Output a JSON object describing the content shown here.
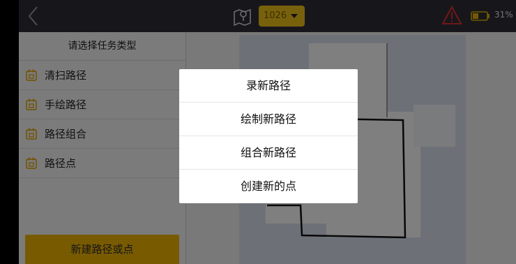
{
  "topbar": {
    "dropdown_value": "1026",
    "battery_percent": "31%",
    "accent": "#f0c21a",
    "icons": [
      "back-chevron-icon",
      "map-location-icon",
      "warning-icon",
      "battery-icon"
    ]
  },
  "panel": {
    "title": "请选择任务类型",
    "items": [
      {
        "label": "清扫路径"
      },
      {
        "label": "手绘路径"
      },
      {
        "label": "路径组合"
      },
      {
        "label": "路径点"
      }
    ],
    "new_button": "新建路径或点"
  },
  "dialog": {
    "options": [
      {
        "label": "录新路径"
      },
      {
        "label": "绘制新路径"
      },
      {
        "label": "组合新路径"
      },
      {
        "label": "创建新的点"
      }
    ]
  }
}
